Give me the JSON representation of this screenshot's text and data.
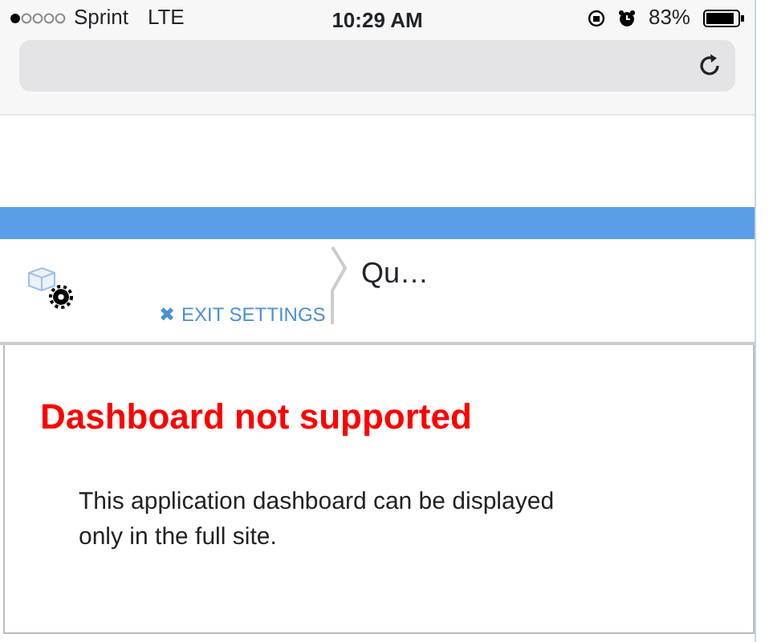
{
  "status_bar": {
    "carrier": "Sprint",
    "network": "LTE",
    "time": "10:29 AM",
    "battery": "83%"
  },
  "header": {
    "exit_label": "EXIT SETTINGS",
    "exit_icon": "✖",
    "breadcrumb": "Qu…"
  },
  "message": {
    "title": "Dashboard not supported",
    "body": "This application dashboard can be displayed only in the full site."
  }
}
